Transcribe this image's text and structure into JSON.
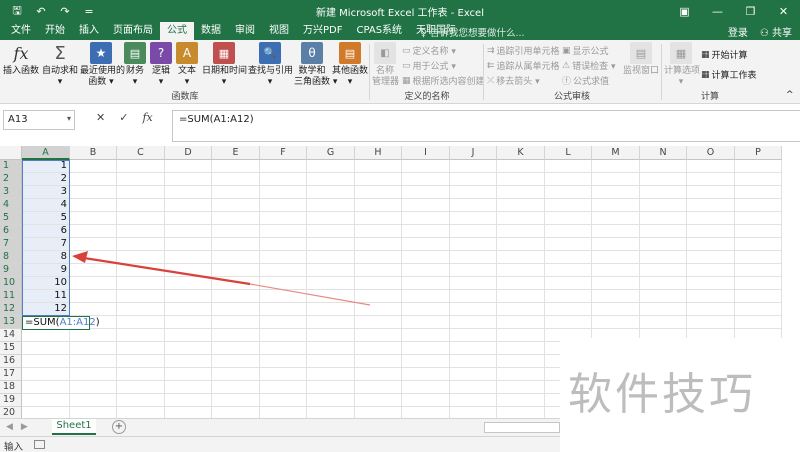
{
  "titlebar": {
    "title": "新建 Microsoft Excel 工作表 - Excel",
    "qat": [
      {
        "name": "save-icon",
        "glyph": "🖫"
      },
      {
        "name": "undo-icon",
        "glyph": "↶"
      },
      {
        "name": "redo-icon",
        "glyph": "↷"
      },
      {
        "name": "customize-qat-icon",
        "glyph": "="
      }
    ],
    "window_buttons": [
      {
        "name": "ribbon-display-options-icon",
        "glyph": "▣"
      },
      {
        "name": "minimize-icon",
        "glyph": "—"
      },
      {
        "name": "restore-icon",
        "glyph": "❐"
      },
      {
        "name": "close-icon",
        "glyph": "✕"
      }
    ]
  },
  "tabs": [
    "文件",
    "开始",
    "插入",
    "页面布局",
    "公式",
    "数据",
    "审阅",
    "视图",
    "万兴PDF",
    "CPAS系统",
    "天职国际"
  ],
  "active_tab": "公式",
  "tell_me": "告诉我您想要做什么...",
  "account": {
    "login": "登录",
    "share": "共享"
  },
  "ribbon": {
    "function_library": {
      "label": "函数库",
      "buttons": [
        {
          "name": "insert-function-button",
          "icon": "fx",
          "lines": [
            "插入函数",
            ""
          ]
        },
        {
          "name": "autosum-button",
          "icon": "Σ",
          "lines": [
            "自动求和",
            "▾"
          ]
        },
        {
          "name": "recently-used-button",
          "icon": "★",
          "lines": [
            "最近使用的",
            "函数 ▾"
          ]
        },
        {
          "name": "financial-button",
          "icon": "▤",
          "lines": [
            "财务",
            "▾"
          ]
        },
        {
          "name": "logical-button",
          "icon": "?",
          "lines": [
            "逻辑",
            "▾"
          ]
        },
        {
          "name": "text-button",
          "icon": "A",
          "lines": [
            "文本",
            "▾"
          ]
        },
        {
          "name": "date-time-button",
          "icon": "▦",
          "lines": [
            "日期和时间",
            "▾"
          ]
        },
        {
          "name": "lookup-reference-button",
          "icon": "🔍",
          "lines": [
            "查找与引用",
            "▾"
          ]
        },
        {
          "name": "math-trig-button",
          "icon": "θ",
          "lines": [
            "数学和",
            "三角函数 ▾"
          ]
        },
        {
          "name": "more-functions-button",
          "icon": "▤",
          "lines": [
            "其他函数",
            "▾"
          ]
        }
      ]
    },
    "defined_names": {
      "label": "定义的名称",
      "name_manager": [
        "名称",
        "管理器"
      ],
      "items": [
        "定义名称 ▾",
        "用于公式 ▾",
        "根据所选内容创建"
      ]
    },
    "formula_auditing": {
      "label": "公式审核",
      "left": [
        "追踪引用单元格",
        "追踪从属单元格",
        "移去箭头 ▾"
      ],
      "right": [
        "显示公式",
        "错误检查 ▾",
        "公式求值"
      ],
      "watch_window": "监视窗口"
    },
    "calculation": {
      "label": "计算",
      "options": [
        "计算选项",
        "▾"
      ],
      "calc_now": "开始计算",
      "calc_sheet": "计算工作表"
    }
  },
  "formula_bar": {
    "name_box": "A13",
    "cancel": "✕",
    "enter": "✓",
    "fx": "fx",
    "formula": "=SUM(A1:A12)"
  },
  "grid": {
    "columns": [
      "A",
      "B",
      "C",
      "D",
      "E",
      "F",
      "G",
      "H",
      "I",
      "J",
      "K",
      "L",
      "M",
      "N",
      "O",
      "P"
    ],
    "rows": [
      "1",
      "2",
      "3",
      "4",
      "5",
      "6",
      "7",
      "8",
      "9",
      "10",
      "11",
      "12",
      "13",
      "14",
      "15",
      "16",
      "17",
      "18",
      "19",
      "20"
    ],
    "column_a_values": [
      "1",
      "2",
      "3",
      "4",
      "5",
      "6",
      "7",
      "8",
      "9",
      "10",
      "11",
      "12"
    ],
    "editing_cell": {
      "prefix": "=SUM(",
      "ref": "A1:A12",
      "suffix": ")"
    }
  },
  "sheets": [
    "Sheet1"
  ],
  "status": {
    "mode": "输入"
  },
  "watermark": "软件技巧",
  "colors": {
    "excel_green": "#217346",
    "selection_blue": "#4f7ec4",
    "arrow_red": "#d9413a"
  }
}
